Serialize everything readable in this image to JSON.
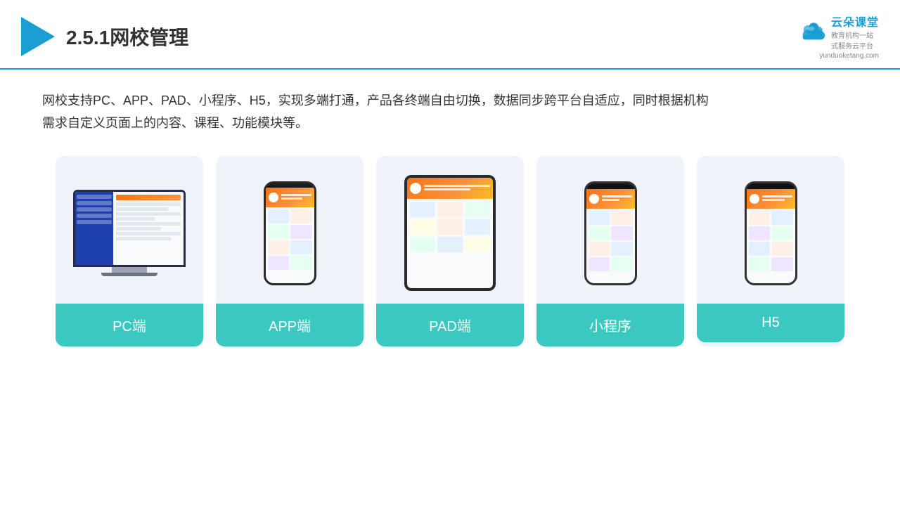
{
  "header": {
    "title": "2.5.1网校管理",
    "brand_name": "云朵课堂",
    "brand_url": "yunduoketang.com",
    "brand_tagline": "教育机构一站\n式服务云平台"
  },
  "description": {
    "line1": "网校支持PC、APP、PAD、小程序、H5，实现多端打通，产品各终端自由切换，数据同步跨平台自适应，同时根据机构",
    "line2": "需求自定义页面上的内容、课程、功能模块等。"
  },
  "cards": [
    {
      "id": "pc",
      "label": "PC端"
    },
    {
      "id": "app",
      "label": "APP端"
    },
    {
      "id": "pad",
      "label": "PAD端"
    },
    {
      "id": "miniapp",
      "label": "小程序"
    },
    {
      "id": "h5",
      "label": "H5"
    }
  ],
  "colors": {
    "accent": "#1a9ed4",
    "card_bg": "#eef2f8",
    "card_label_bg": "#3bc8c0"
  }
}
